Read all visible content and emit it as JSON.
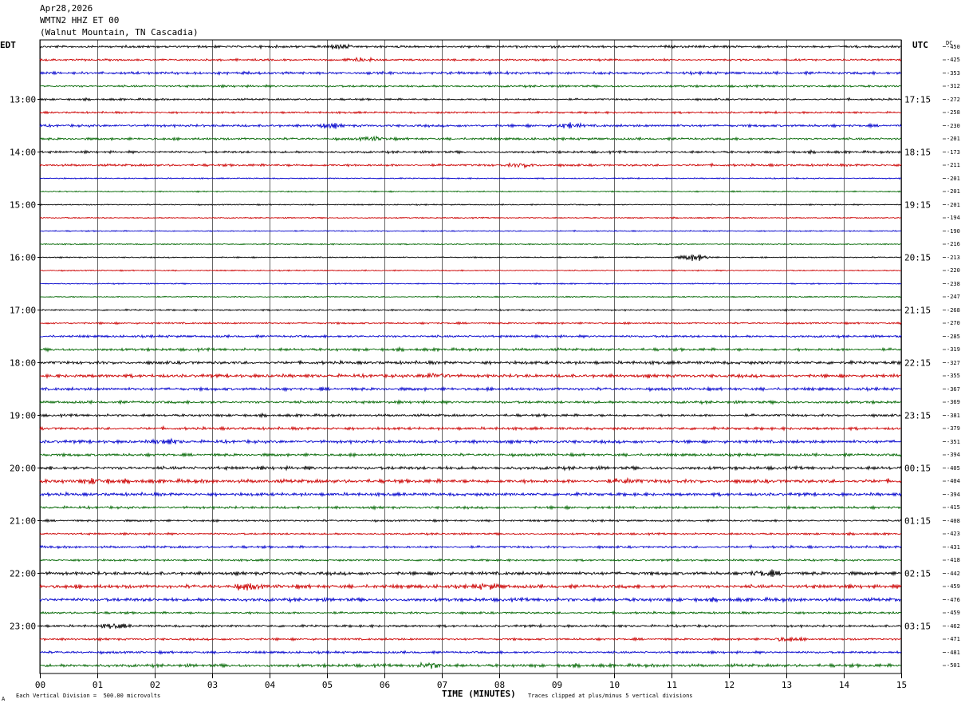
{
  "header": {
    "date": "Apr28,2026",
    "channel": "WMTN2 HHZ ET 00",
    "station": "(Walnut Mountain, TN Cascadia)"
  },
  "labels": {
    "left_tz": "EDT",
    "right_tz": "UTC",
    "dc": "DC",
    "xlabel": "TIME (MINUTES)",
    "scale_note": "Each Vertical Division =  500.00 microvolts",
    "clip_note": "Traces clipped at plus/minus 5 vertical divisions",
    "corner_mark": "A"
  },
  "chart_data": {
    "type": "line",
    "x_ticks": [
      "00",
      "01",
      "02",
      "03",
      "04",
      "05",
      "06",
      "07",
      "08",
      "09",
      "10",
      "11",
      "12",
      "13",
      "14",
      "15"
    ],
    "xlim": [
      0,
      15
    ],
    "grid": "vertical lines each minute",
    "trace_colors": [
      "#000000",
      "#cc0000",
      "#0000cc",
      "#006600"
    ],
    "left_times": [
      "13:00",
      "14:00",
      "15:00",
      "16:00",
      "17:00",
      "18:00",
      "19:00",
      "20:00",
      "21:00",
      "22:00",
      "23:00"
    ],
    "right_times": [
      "17:15",
      "18:15",
      "19:15",
      "20:15",
      "21:15",
      "22:15",
      "23:15",
      "00:15",
      "01:15",
      "02:15",
      "03:15"
    ],
    "dc_offsets": [
      "-450",
      "-425",
      "-353",
      "-312",
      "-272",
      "-258",
      "-230",
      "-201",
      "-173",
      "-211",
      "-201",
      "-201",
      "-201",
      "-194",
      "-190",
      "-216",
      "-213",
      "-220",
      "-238",
      "-247",
      "-268",
      "-270",
      "-285",
      "-319",
      "-327",
      "-355",
      "-367",
      "-369",
      "-381",
      "-379",
      "-351",
      "-394",
      "-405",
      "-404",
      "-394",
      "-415",
      "-408",
      "-423",
      "-431",
      "-418",
      "-442",
      "-459",
      "-476",
      "-459",
      "-462",
      "-471",
      "-481",
      "-501"
    ],
    "trace_amplitude": [
      1.2,
      1.0,
      1.4,
      1.1,
      1.0,
      1.0,
      1.3,
      1.2,
      1.2,
      1.2,
      0.6,
      0.6,
      0.6,
      0.6,
      0.6,
      0.6,
      0.6,
      0.6,
      0.6,
      0.6,
      0.8,
      0.9,
      1.2,
      1.4,
      1.6,
      1.7,
      1.5,
      1.4,
      1.3,
      1.4,
      1.6,
      1.4,
      1.7,
      1.9,
      1.6,
      1.3,
      1.0,
      1.0,
      1.2,
      1.0,
      1.7,
      1.9,
      1.8,
      1.1,
      1.2,
      1.1,
      1.2,
      1.6
    ],
    "events": [
      {
        "trace": 0,
        "minute": 5.2,
        "amp": 2.2
      },
      {
        "trace": 1,
        "minute": 5.6,
        "amp": 1.8
      },
      {
        "trace": 6,
        "minute": 5.0,
        "amp": 2.0
      },
      {
        "trace": 6,
        "minute": 9.2,
        "amp": 2.2
      },
      {
        "trace": 7,
        "minute": 5.8,
        "amp": 2.0
      },
      {
        "trace": 9,
        "minute": 8.4,
        "amp": 2.0
      },
      {
        "trace": 16,
        "minute": 11.4,
        "amp": 4.0
      },
      {
        "trace": 25,
        "minute": 6.9,
        "amp": 3.0
      },
      {
        "trace": 30,
        "minute": 2.2,
        "amp": 2.0
      },
      {
        "trace": 33,
        "minute": 1.0,
        "amp": 2.2
      },
      {
        "trace": 33,
        "minute": 10.2,
        "amp": 2.0
      },
      {
        "trace": 40,
        "minute": 12.6,
        "amp": 2.5
      },
      {
        "trace": 41,
        "minute": 3.6,
        "amp": 2.5
      },
      {
        "trace": 41,
        "minute": 7.8,
        "amp": 2.2
      },
      {
        "trace": 44,
        "minute": 1.3,
        "amp": 2.2
      },
      {
        "trace": 45,
        "minute": 13.0,
        "amp": 2.0
      },
      {
        "trace": 47,
        "minute": 6.8,
        "amp": 2.6
      }
    ]
  }
}
